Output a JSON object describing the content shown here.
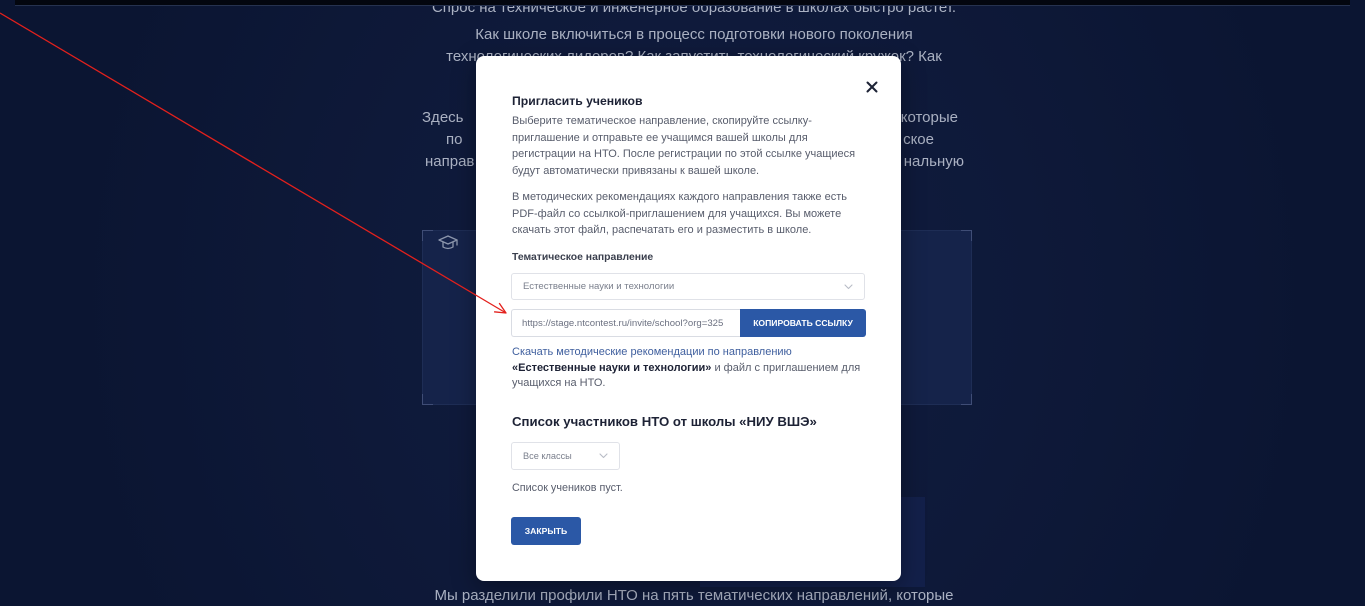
{
  "page": {
    "intro_lines": [
      "Спрос на техническое и инженерное образование в школах быстро растет.",
      "Как школе включиться в процесс подготовки нового поколения",
      "технологических лидеров? Как запустить технологический кружок? Как"
    ],
    "left_fragments": [
      "Здесь",
      "по",
      "направ"
    ],
    "right_fragments": [
      "которые",
      "ское",
      "нальную"
    ],
    "card_icon": "graduation-cap-icon",
    "bottom_line": "Мы разделили профили НТО на пять тематических направлений, которые"
  },
  "modal": {
    "title": "Пригласить учеников",
    "close_icon": "close-icon",
    "intro_lines": [
      "Выберите тематическое направление, скопируйте ссылку-",
      "приглашение и отправьте ее учащимся вашей школы для",
      "регистрации на НТО. После регистрации по этой ссылке учащиеся",
      "будут автоматически привязаны к вашей школе."
    ],
    "pdf_lines": [
      "В методических рекомендациях каждого направления также есть",
      "PDF-файл со ссылкой-приглашением для учащихся. Вы можете",
      "скачать этот файл, распечатать его и разместить в школе."
    ],
    "direction_label": "Тематическое направление",
    "direction_select": {
      "value": "Естественные науки и технологии",
      "icon": "chevron-down-icon"
    },
    "invite_link": {
      "value": "https://stage.ntcontest.ru/invite/school?org=325"
    },
    "copy_button": "КОПИРОВАТЬ ССЫЛКУ",
    "download": {
      "link_text": "Скачать методические рекомендации по направлению",
      "direction_name": "«Естественные науки и технологии»",
      "suffix": " и файл с приглашением для",
      "last_line": "учащихся на НТО."
    },
    "participants_title": "Список участников НТО от школы «НИУ ВШЭ»",
    "class_select": {
      "value": "Все классы",
      "icon": "chevron-down-icon"
    },
    "empty_text": "Список учеников пуст.",
    "close_button": "ЗАКРЫТЬ"
  },
  "annotation": {
    "type": "arrow",
    "color": "#e3201c"
  },
  "colors": {
    "page_bg": "#0e1939",
    "card_bg": "#15234a",
    "modal_bg": "#ffffff",
    "accent": "#2b58a6",
    "link": "#3f5f9e",
    "heading": "#1d2235",
    "body_text": "#585d6c"
  }
}
